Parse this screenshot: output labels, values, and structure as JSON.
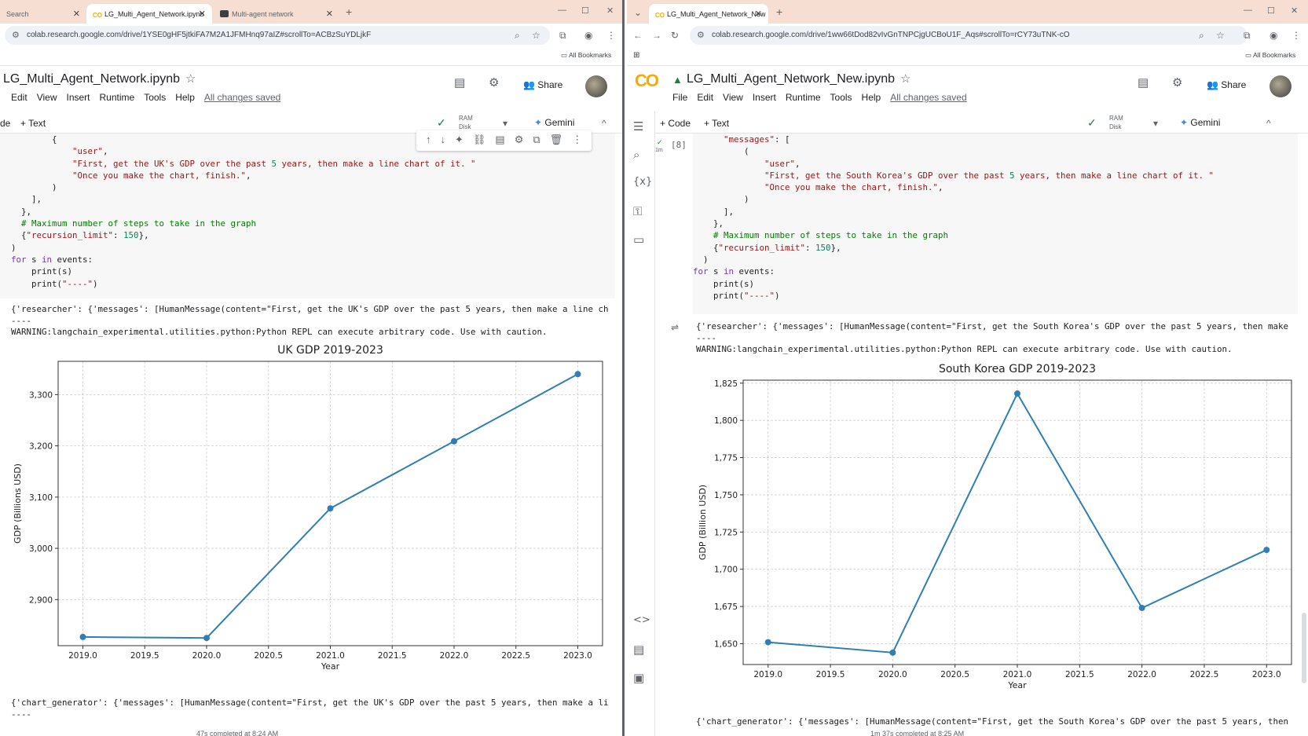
{
  "left": {
    "tabs": [
      {
        "label": "Search"
      },
      {
        "label": "LG_Multi_Agent_Network.ipynb"
      },
      {
        "label": "Multi-agent network"
      }
    ],
    "url": "colab.research.google.com/drive/1YSE0gHF5jtkiFA7M2A1JFMHnq97aIZ#scrollTo=ACBzSuYDLjkF",
    "bookmarks_label": "All Bookmarks",
    "notebook_title": "LG_Multi_Agent_Network.ipynb",
    "menu": [
      "Edit",
      "View",
      "Insert",
      "Runtime",
      "Tools",
      "Help"
    ],
    "saved_label": "All changes saved",
    "share_label": "Share",
    "toolbar": {
      "code_label": "de",
      "text_label": "+ Text",
      "ram": "RAM",
      "disk": "Disk",
      "gemini": "Gemini"
    },
    "code_lines": [
      "        {",
      "            \"user\",",
      "            \"First, get the UK's GDP over the past 5 years, then make a line chart of it. \"",
      "            \"Once you make the chart, finish.\",",
      "        )",
      "    ],",
      "  },",
      "  # Maximum number of steps to take in the graph",
      "  {\"recursion_limit\": 150},",
      ")",
      "for s in events:",
      "    print(s)",
      "    print(\"----\")"
    ],
    "output_top": [
      "{'researcher': {'messages': [HumanMessage(content=\"First, get the UK's GDP over the past 5 years, then make a line ch",
      "----",
      "WARNING:langchain_experimental.utilities.python:Python REPL can execute arbitrary code. Use with caution."
    ],
    "output_bottom": [
      "{'chart_generator': {'messages': [HumanMessage(content=\"First, get the UK's GDP over the past 5 years, then make a li",
      "----"
    ],
    "status": "47s   completed at 8:24 AM"
  },
  "right": {
    "tabs": [
      {
        "label": "LG_Multi_Agent_Network_New"
      }
    ],
    "url": "colab.research.google.com/drive/1ww66tDod82vIvGnTNPCjgUCBoU1F_Aqs#scrollTo=rCY73uTNK-cO",
    "bookmarks_label": "All Bookmarks",
    "logo": "CO",
    "notebook_title": "LG_Multi_Agent_Network_New.ipynb",
    "menu": [
      "File",
      "Edit",
      "View",
      "Insert",
      "Runtime",
      "Tools",
      "Help"
    ],
    "saved_label": "All changes saved",
    "share_label": "Share",
    "toolbar": {
      "code_label": "+ Code",
      "text_label": "+ Text",
      "ram": "RAM",
      "disk": "Disk",
      "gemini": "Gemini"
    },
    "cell_index": "[8]",
    "cell_time": "1m",
    "code_lines": [
      "      \"messages\": [",
      "          (",
      "              \"user\",",
      "              \"First, get the South Korea's GDP over the past 5 years, then make a line chart of it. \"",
      "              \"Once you make the chart, finish.\",",
      "          )",
      "      ],",
      "    },",
      "    # Maximum number of steps to take in the graph",
      "    {\"recursion_limit\": 150},",
      "  )",
      "for s in events:",
      "    print(s)",
      "    print(\"----\")"
    ],
    "output_top": [
      "{'researcher': {'messages': [HumanMessage(content=\"First, get the South Korea's GDP over the past 5 years, then make",
      "----",
      "WARNING:langchain_experimental.utilities.python:Python REPL can execute arbitrary code. Use with caution."
    ],
    "output_bottom": [
      "{'chart_generator': {'messages': [HumanMessage(content=\"First, get the South Korea's GDP over the past 5 years, then"
    ],
    "status": "1m 37s   completed at 8:25 AM"
  },
  "colors": {
    "line": "#2f7fb5",
    "tabbar": "#f6ded3",
    "colab_orange": "#f9ab00"
  },
  "chart_data": [
    {
      "type": "line",
      "title": "UK GDP 2019-2023",
      "xlabel": "Year",
      "ylabel": "GDP (Billions USD)",
      "x": [
        2019,
        2020,
        2021,
        2022,
        2023
      ],
      "y": [
        2827,
        2825,
        3078,
        3209,
        3340
      ],
      "xlim": [
        2018.8,
        2023.2
      ],
      "ylim": [
        2810,
        3365
      ],
      "xticks": [
        "2019.0",
        "2019.5",
        "2020.0",
        "2020.5",
        "2021.0",
        "2021.5",
        "2022.0",
        "2022.5",
        "2023.0"
      ],
      "yticks": [
        "2,900",
        "3,000",
        "3,100",
        "3,200",
        "3,300"
      ],
      "grid": true,
      "markers": true
    },
    {
      "type": "line",
      "title": "South Korea GDP 2019-2023",
      "xlabel": "Year",
      "ylabel": "GDP (Billion USD)",
      "x": [
        2019,
        2020,
        2021,
        2022,
        2023
      ],
      "y": [
        1651,
        1644,
        1818,
        1674,
        1713
      ],
      "xlim": [
        2018.8,
        2023.2
      ],
      "ylim": [
        1636,
        1827
      ],
      "xticks": [
        "2019.0",
        "2019.5",
        "2020.0",
        "2020.5",
        "2021.0",
        "2021.5",
        "2022.0",
        "2022.5",
        "2023.0"
      ],
      "yticks": [
        "1,650",
        "1,675",
        "1,700",
        "1,725",
        "1,750",
        "1,775",
        "1,800",
        "1,825"
      ],
      "grid": true,
      "markers": true
    }
  ]
}
